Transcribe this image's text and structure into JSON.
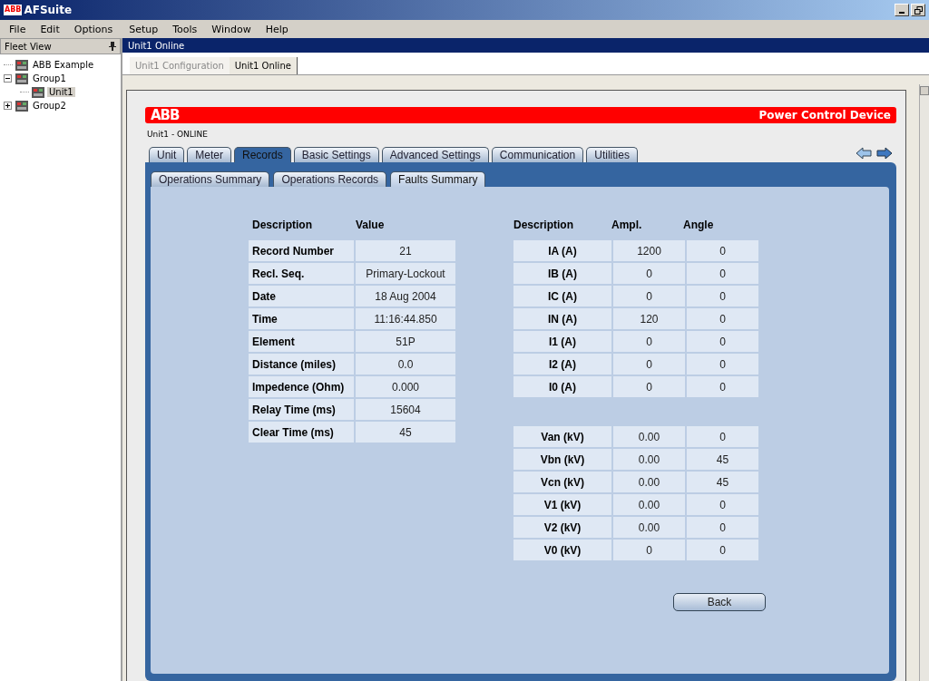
{
  "window": {
    "logo": "ABB",
    "title": "AFSuite"
  },
  "menu": [
    "File",
    "Edit",
    "Options",
    "Setup",
    "Tools",
    "Window",
    "Help"
  ],
  "fleet_view": {
    "title": "Fleet View",
    "tree": [
      {
        "label": "ABB Example",
        "selected": false
      },
      {
        "label": "Group1",
        "expanded": true,
        "selected": false,
        "children": [
          {
            "label": "Unit1",
            "selected": true
          }
        ]
      },
      {
        "label": "Group2",
        "expanded": false,
        "selected": false
      }
    ]
  },
  "document": {
    "title": "Unit1 Online",
    "tabs": [
      {
        "label": "Unit1 Configuration",
        "selected": false
      },
      {
        "label": "Unit1 Online",
        "selected": true
      }
    ]
  },
  "device": {
    "logo": "ABB",
    "product": "Power Control Device",
    "status": "Unit1 - ONLINE",
    "tabs": [
      {
        "label": "Unit",
        "selected": false
      },
      {
        "label": "Meter",
        "selected": false
      },
      {
        "label": "Records",
        "selected": true
      },
      {
        "label": "Basic Settings",
        "selected": false
      },
      {
        "label": "Advanced Settings",
        "selected": false
      },
      {
        "label": "Communication",
        "selected": false
      },
      {
        "label": "Utilities",
        "selected": false
      }
    ],
    "subtabs": [
      {
        "label": "Operations Summary",
        "selected": false
      },
      {
        "label": "Operations Records",
        "selected": false
      },
      {
        "label": "Faults Summary",
        "selected": true
      }
    ]
  },
  "record_table": {
    "columns": [
      "Description",
      "Value"
    ],
    "rows": [
      [
        "Record Number",
        "21"
      ],
      [
        "Recl. Seq.",
        "Primary-Lockout"
      ],
      [
        "Date",
        "18 Aug 2004"
      ],
      [
        "Time",
        "11:16:44.850"
      ],
      [
        "Element",
        "51P"
      ],
      [
        "Distance (miles)",
        "0.0"
      ],
      [
        "Impedence (Ohm)",
        "0.000"
      ],
      [
        "Relay Time (ms)",
        "15604"
      ],
      [
        "Clear Time (ms)",
        "45"
      ]
    ]
  },
  "phasor_table": {
    "columns": [
      "Description",
      "Ampl.",
      "Angle"
    ],
    "current_rows": [
      [
        "IA (A)",
        "1200",
        "0"
      ],
      [
        "IB (A)",
        "0",
        "0"
      ],
      [
        "IC (A)",
        "0",
        "0"
      ],
      [
        "IN (A)",
        "120",
        "0"
      ],
      [
        "I1 (A)",
        "0",
        "0"
      ],
      [
        "I2 (A)",
        "0",
        "0"
      ],
      [
        "I0 (A)",
        "0",
        "0"
      ]
    ],
    "voltage_rows": [
      [
        "Van (kV)",
        "0.00",
        "0"
      ],
      [
        "Vbn (kV)",
        "0.00",
        "45"
      ],
      [
        "Vcn (kV)",
        "0.00",
        "45"
      ],
      [
        "V1 (kV)",
        "0.00",
        "0"
      ],
      [
        "V2 (kV)",
        "0.00",
        "0"
      ],
      [
        "V0 (kV)",
        "0",
        "0"
      ]
    ]
  },
  "back_button": "Back"
}
